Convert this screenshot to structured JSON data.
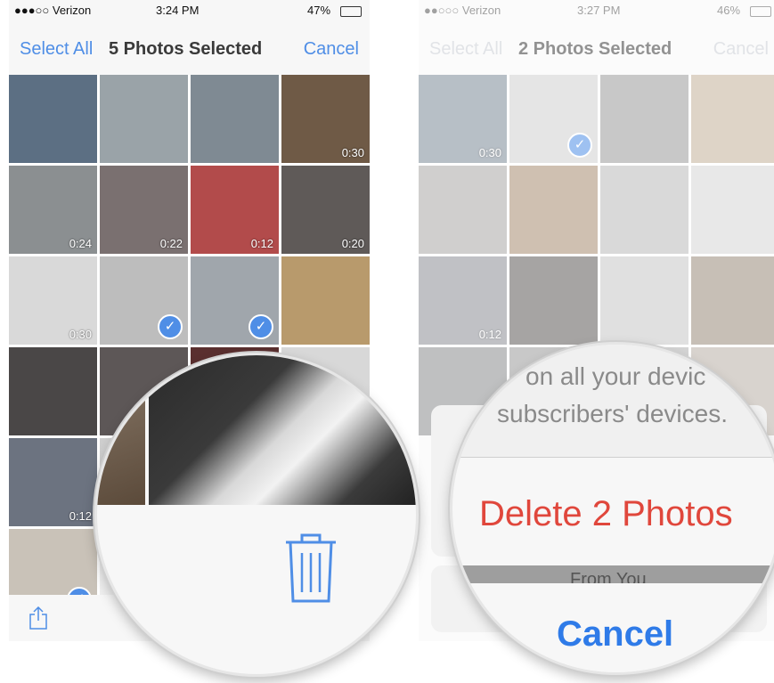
{
  "left_screen": {
    "status": {
      "carrier": "●●●○○ Verizon",
      "time": "3:24 PM",
      "battery": "47%"
    },
    "nav": {
      "left_label": "Select All",
      "title": "5 Photos Selected",
      "right_label": "Cancel"
    },
    "tiles": [
      {
        "duration": "",
        "checked": false,
        "color": "#5c6f83"
      },
      {
        "duration": "",
        "checked": false,
        "color": "#9aa3a8"
      },
      {
        "duration": "",
        "checked": false,
        "color": "#7f8a93"
      },
      {
        "duration": "0:30",
        "checked": false,
        "color": "#6f5a46"
      },
      {
        "duration": "0:24",
        "checked": false,
        "color": "#8b8f91"
      },
      {
        "duration": "0:22",
        "checked": false,
        "color": "#7a7070"
      },
      {
        "duration": "0:12",
        "checked": false,
        "color": "#b24b4b"
      },
      {
        "duration": "0:20",
        "checked": false,
        "color": "#5f5a58"
      },
      {
        "duration": "0:30",
        "checked": false,
        "color": "#d9d9d9"
      },
      {
        "duration": "",
        "checked": true,
        "color": "#bdbdbd"
      },
      {
        "duration": "",
        "checked": true,
        "color": "#a0a6ac"
      },
      {
        "duration": "",
        "checked": false,
        "color": "#b89a6c"
      },
      {
        "duration": "",
        "checked": false,
        "color": "#4a4747"
      },
      {
        "duration": "",
        "checked": false,
        "color": "#5d5757"
      },
      {
        "duration": "",
        "checked": false,
        "color": "#5a2f2f"
      },
      {
        "duration": "",
        "checked": false,
        "color": "#d8d8d8"
      },
      {
        "duration": "0:12",
        "checked": false,
        "color": "#6c7380"
      },
      {
        "duration": "",
        "checked": false,
        "color": "#cfcfcf"
      },
      {
        "duration": "",
        "checked": false,
        "color": "#e7e7e7"
      },
      {
        "duration": "",
        "checked": false,
        "color": "#e7e7e7"
      },
      {
        "duration": "",
        "checked": true,
        "color": "#c9c2b8"
      },
      {
        "duration": "",
        "checked": false,
        "color": "#efefef"
      },
      {
        "duration": "",
        "checked": false,
        "color": "#efefef"
      },
      {
        "duration": "",
        "checked": false,
        "color": "#efefef"
      }
    ]
  },
  "right_screen": {
    "status": {
      "carrier": "●●○○○ Verizon",
      "time": "3:27 PM",
      "battery": "46%"
    },
    "nav": {
      "left_label": "Select All",
      "title": "2 Photos Selected",
      "right_label": "Cancel"
    },
    "tiles": [
      {
        "duration": "0:30",
        "checked": false,
        "color": "#7c8a97"
      },
      {
        "duration": "",
        "checked": true,
        "color": "#cfcfcf"
      },
      {
        "duration": "",
        "checked": false,
        "color": "#9c9c9c"
      },
      {
        "duration": "",
        "checked": false,
        "color": "#c3b19a"
      },
      {
        "duration": "",
        "checked": false,
        "color": "#aaa8a6"
      },
      {
        "duration": "",
        "checked": false,
        "color": "#a88d72"
      },
      {
        "duration": "",
        "checked": false,
        "color": "#bbbbbb"
      },
      {
        "duration": "",
        "checked": false,
        "color": "#d6d6d6"
      },
      {
        "duration": "0:12",
        "checked": false,
        "color": "#8c8f96"
      },
      {
        "duration": "",
        "checked": false,
        "color": "#5d5a58"
      },
      {
        "duration": "",
        "checked": false,
        "color": "#c7c7c7"
      },
      {
        "duration": "",
        "checked": false,
        "color": "#9a8a7a"
      },
      {
        "duration": "",
        "checked": false,
        "color": "#8a8d8f"
      },
      {
        "duration": "",
        "checked": false,
        "color": "#9b9b9b"
      },
      {
        "duration": "",
        "checked": false,
        "color": "#b1b1b1"
      },
      {
        "duration": "",
        "checked": false,
        "color": "#b9b0a6"
      }
    ],
    "action_sheet": {
      "message_line1": "on all your devic",
      "message_line2": "subscribers' devices.",
      "delete_label": "Delete 2 Photos",
      "partial_label": "From You",
      "cancel_label": "Cancel"
    }
  },
  "icons": {
    "share": "share-icon",
    "trash": "trash-icon",
    "check": "checkmark-icon"
  },
  "colors": {
    "accent_blue": "#4f8ee6",
    "destructive_red": "#e0473c",
    "cancel_blue": "#2f7be8"
  }
}
